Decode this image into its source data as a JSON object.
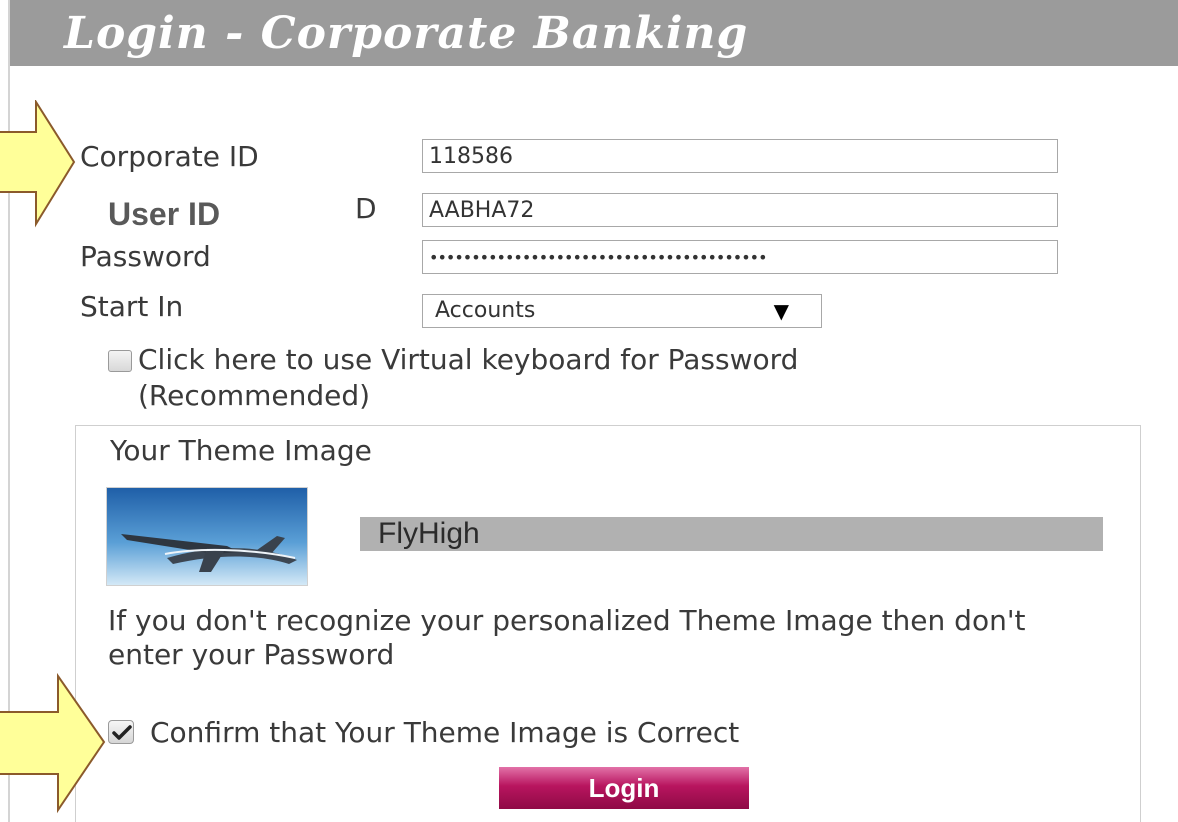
{
  "header": {
    "title": "Login - Corporate Banking"
  },
  "form": {
    "corporate_id": {
      "label": "Corporate ID",
      "value": "118586"
    },
    "user_id": {
      "label": "User ID",
      "label_remnant": "D",
      "value": "AABHA72"
    },
    "password": {
      "label": "Password",
      "masked_value": "••••••••••••••••••••••••••••••••••••••••"
    },
    "start_in": {
      "label": "Start In",
      "selected": "Accounts"
    },
    "virtual_keyboard": {
      "label": "Click here to use Virtual keyboard for Password (Recommended)",
      "checked": false
    }
  },
  "theme": {
    "title": "Your Theme Image",
    "image_icon": "airplane-sky-image",
    "name": "FlyHigh",
    "warning": "If you don't recognize your personalized Theme Image then don't enter your Password",
    "confirm": {
      "label": "Confirm that Your Theme Image is Correct",
      "checked": true
    }
  },
  "actions": {
    "login_label": "Login"
  },
  "annotations": {
    "arrow_color": "#ffff99",
    "arrow_outline": "#8b5a2b"
  },
  "colors": {
    "header_bg": "#9b9b9b",
    "button_accent": "#b8155f",
    "theme_name_bg": "#b1b1b1"
  }
}
